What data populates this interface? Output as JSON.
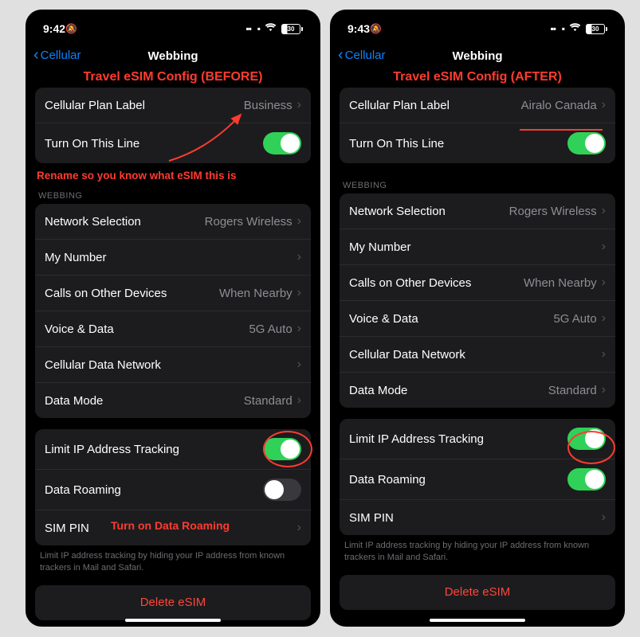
{
  "before": {
    "status_time": "9:42",
    "battery": "30",
    "back_label": "Cellular",
    "nav_title": "Webbing",
    "heading": "Travel eSIM Config (BEFORE)",
    "plan_label_title": "Cellular Plan Label",
    "plan_label_value": "Business",
    "turn_on_label": "Turn On This Line",
    "rename_caption": "Rename so you know what eSIM this is",
    "group_header": "WEBBING",
    "rows": {
      "network_selection": {
        "label": "Network Selection",
        "value": "Rogers Wireless"
      },
      "my_number": {
        "label": "My Number",
        "value": ""
      },
      "calls_other": {
        "label": "Calls on Other Devices",
        "value": "When Nearby"
      },
      "voice_data": {
        "label": "Voice & Data",
        "value": "5G Auto"
      },
      "cdn": {
        "label": "Cellular Data Network",
        "value": ""
      },
      "data_mode": {
        "label": "Data Mode",
        "value": "Standard"
      }
    },
    "limit_ip": "Limit IP Address Tracking",
    "data_roaming": "Data Roaming",
    "sim_pin": "SIM PIN",
    "roaming_caption": "Turn on Data Roaming",
    "footnote": "Limit IP address tracking by hiding your IP address from known trackers in Mail and Safari.",
    "delete": "Delete eSIM"
  },
  "after": {
    "status_time": "9:43",
    "battery": "30",
    "back_label": "Cellular",
    "nav_title": "Webbing",
    "heading": "Travel eSIM Config (AFTER)",
    "plan_label_title": "Cellular Plan Label",
    "plan_label_value": "Airalo Canada",
    "turn_on_label": "Turn On This Line",
    "group_header": "WEBBING",
    "rows": {
      "network_selection": {
        "label": "Network Selection",
        "value": "Rogers Wireless"
      },
      "my_number": {
        "label": "My Number",
        "value": ""
      },
      "calls_other": {
        "label": "Calls on Other Devices",
        "value": "When Nearby"
      },
      "voice_data": {
        "label": "Voice & Data",
        "value": "5G Auto"
      },
      "cdn": {
        "label": "Cellular Data Network",
        "value": ""
      },
      "data_mode": {
        "label": "Data Mode",
        "value": "Standard"
      }
    },
    "limit_ip": "Limit IP Address Tracking",
    "data_roaming": "Data Roaming",
    "sim_pin": "SIM PIN",
    "footnote": "Limit IP address tracking by hiding your IP address from known trackers in Mail and Safari.",
    "delete": "Delete eSIM"
  }
}
